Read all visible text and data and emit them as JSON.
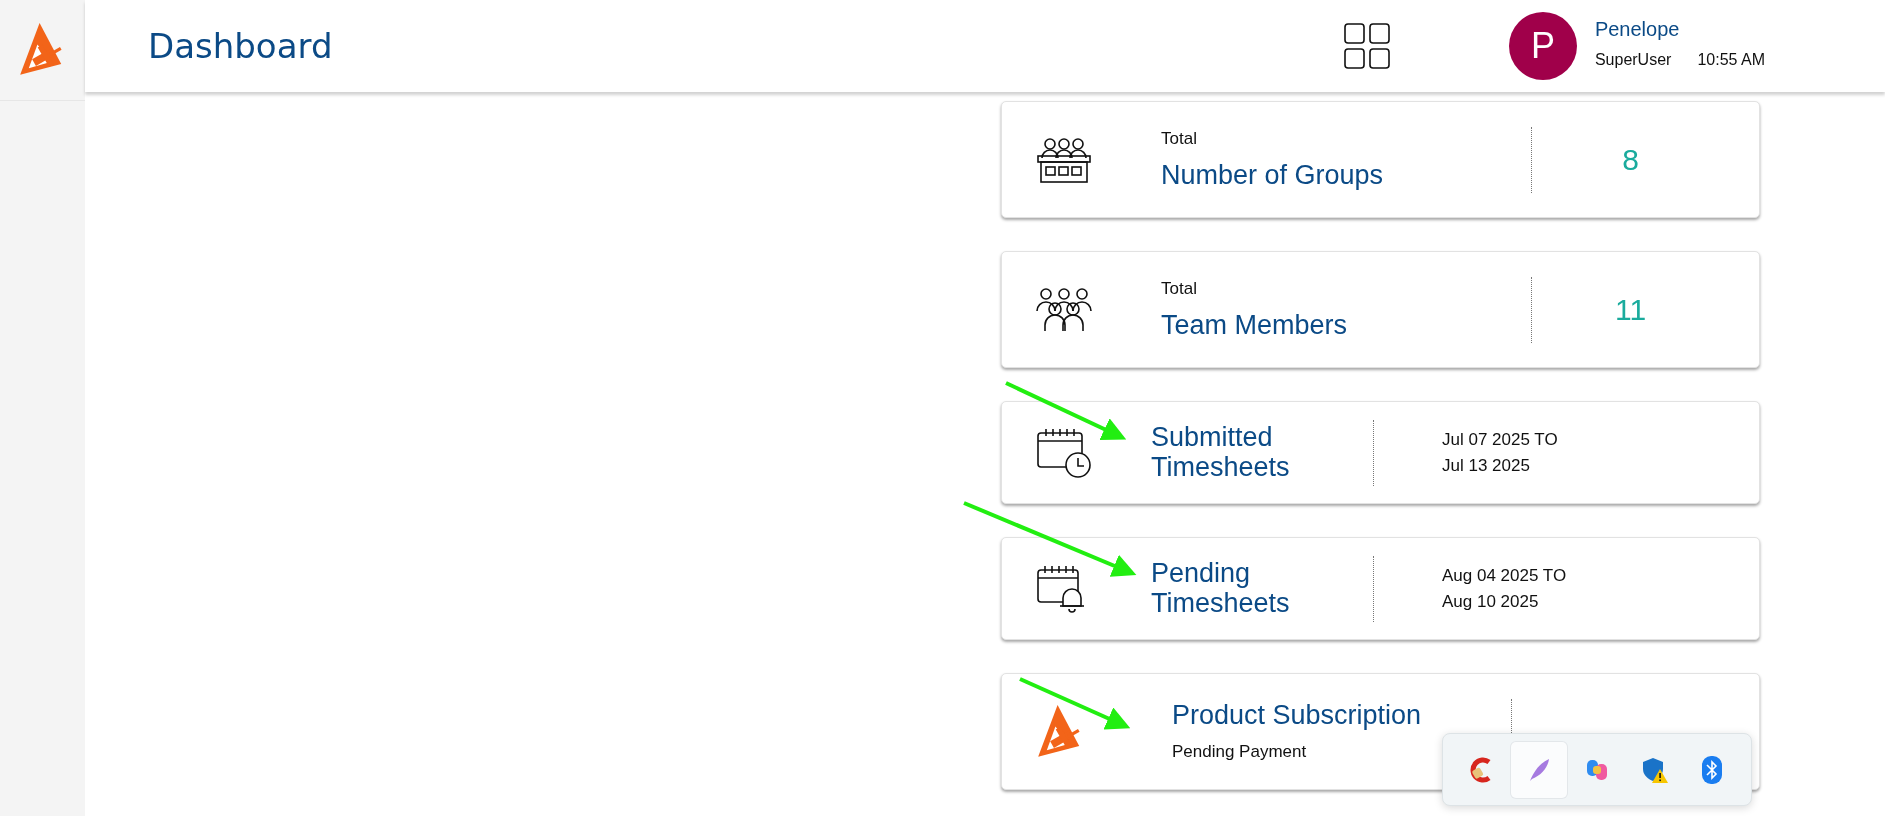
{
  "header": {
    "title": "Dashboard",
    "user": {
      "initial": "P",
      "name": "Penelope",
      "role": "SuperUser",
      "time": "10:55 AM"
    }
  },
  "cards": [
    {
      "kind": "total",
      "label": "Total",
      "title": "Number of Groups",
      "value": "8"
    },
    {
      "kind": "total",
      "label": "Total",
      "title": "Team Members",
      "value": "11"
    },
    {
      "kind": "range",
      "title": "Submitted Timesheets",
      "range_start": "Jul 07 2025 TO",
      "range_end": "Jul 13 2025"
    },
    {
      "kind": "range",
      "title": "Pending Timesheets",
      "range_start": "Aug 04 2025 TO",
      "range_end": "Aug 10 2025"
    },
    {
      "kind": "subscription",
      "title": "Product Subscription",
      "subtitle": "Pending Payment"
    }
  ],
  "tray": {
    "items": [
      {
        "kind": "cleaner",
        "selected": false
      },
      {
        "kind": "feather",
        "selected": true
      },
      {
        "kind": "copilot",
        "selected": false
      },
      {
        "kind": "shield-warning",
        "selected": false
      },
      {
        "kind": "bluetooth",
        "selected": false
      }
    ]
  },
  "annotations": [
    {
      "kind": "arrow"
    },
    {
      "kind": "arrow"
    },
    {
      "kind": "arrow"
    }
  ]
}
